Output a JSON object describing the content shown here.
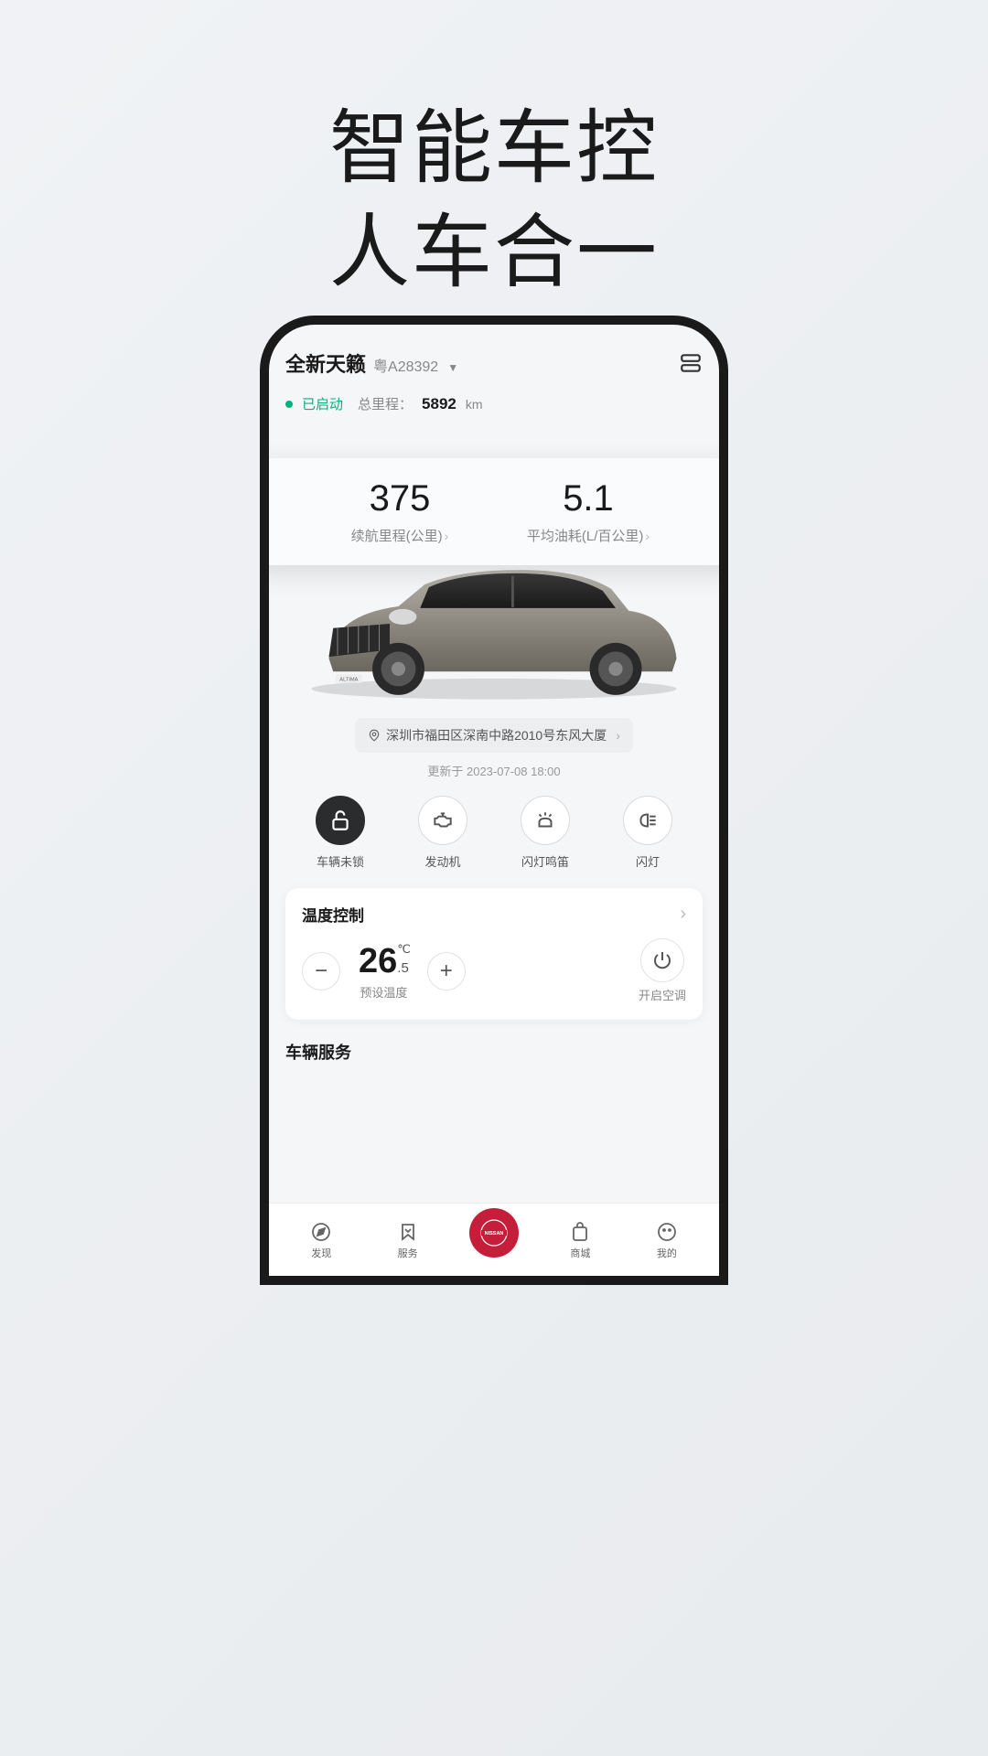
{
  "promo": {
    "line1": "智能车控",
    "line2": "人车合一"
  },
  "header": {
    "car_name": "全新天籁",
    "plate": "粤A28392"
  },
  "status": {
    "text": "已启动",
    "mileage_label": "总里程：",
    "mileage_value": "5892",
    "mileage_unit": "km"
  },
  "stats": {
    "range_value": "375",
    "range_label": "续航里程(公里)",
    "fuel_value": "5.1",
    "fuel_label": "平均油耗(L/百公里)"
  },
  "location": {
    "address": "深圳市福田区深南中路2010号东风大厦"
  },
  "update": {
    "prefix": "更新于",
    "time": "2023-07-08 18:00"
  },
  "quick_actions": [
    {
      "label": "车辆未锁"
    },
    {
      "label": "发动机"
    },
    {
      "label": "闪灯鸣笛"
    },
    {
      "label": "闪灯"
    }
  ],
  "temperature": {
    "title": "温度控制",
    "value_main": "26",
    "value_sub": ".5",
    "unit": "℃",
    "caption": "预设温度",
    "ac_label": "开启空调"
  },
  "services": {
    "title": "车辆服务"
  },
  "nav": {
    "discover": "发现",
    "service": "服务",
    "center": "NISSAN",
    "shop": "商城",
    "mine": "我的"
  }
}
